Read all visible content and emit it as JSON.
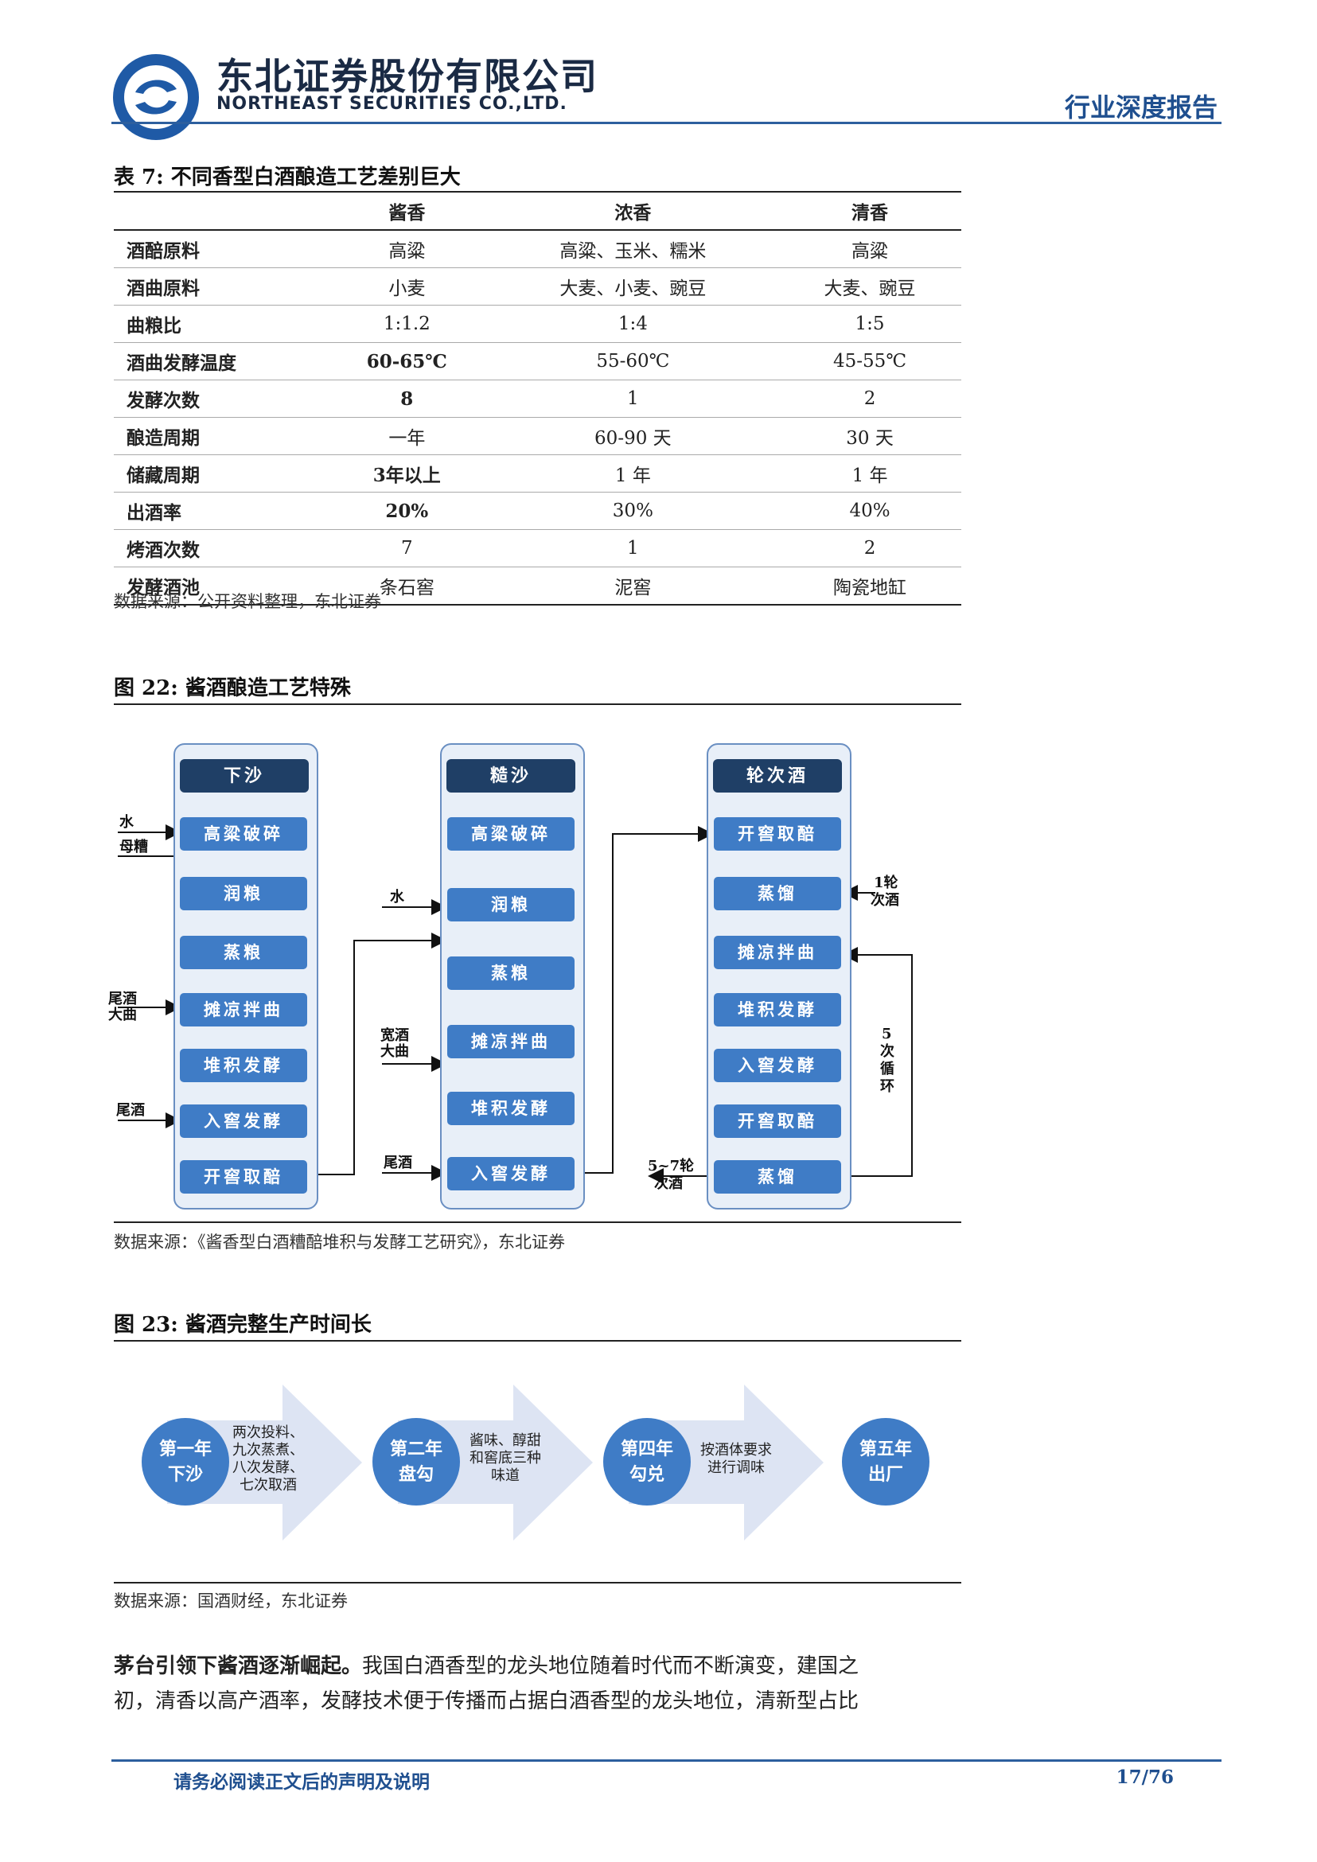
{
  "header": {
    "company_cn": "东北证券股份有限公司",
    "company_en": "NORTHEAST SECURITIES CO.,LTD.",
    "report_type": "行业深度报告"
  },
  "table7": {
    "title": "表 7: 不同香型白酒酿造工艺差别巨大",
    "columns": [
      "",
      "酱香",
      "浓香",
      "清香"
    ],
    "rows": [
      [
        "酒醅原料",
        "高粱",
        "高粱、玉米、糯米",
        "高粱"
      ],
      [
        "酒曲原料",
        "小麦",
        "大麦、小麦、豌豆",
        "大麦、豌豆"
      ],
      [
        "曲粮比",
        "1:1.2",
        "1:4",
        "1:5"
      ],
      [
        "酒曲发酵温度",
        "60-65℃",
        "55-60℃",
        "45-55℃"
      ],
      [
        "发酵次数",
        "8",
        "1",
        "2"
      ],
      [
        "酿造周期",
        "一年",
        "60-90 天",
        "30 天"
      ],
      [
        "储藏周期",
        "3年以上",
        "1 年",
        "1 年"
      ],
      [
        "出酒率",
        "20%",
        "30%",
        "40%"
      ],
      [
        "烤酒次数",
        "7",
        "1",
        "2"
      ],
      [
        "发酵酒池",
        "条石窖",
        "泥窖",
        "陶瓷地缸"
      ]
    ],
    "source": "数据来源：公开资料整理，东北证券"
  },
  "fig22": {
    "title": "图 22: 酱酒酿造工艺特殊",
    "col1": {
      "head": "下沙",
      "steps": [
        "高粱破碎",
        "润粮",
        "蒸粮",
        "摊凉拌曲",
        "堆积发酵",
        "入窖发酵",
        "开窖取醅"
      ]
    },
    "col2": {
      "head": "糙沙",
      "steps": [
        "高粱破碎",
        "润粮",
        "蒸粮",
        "摊凉拌曲",
        "堆积发酵",
        "入窖发酵"
      ]
    },
    "col3": {
      "head": "轮次酒",
      "steps": [
        "开窖取醅",
        "蒸馏",
        "摊凉拌曲",
        "堆积发酵",
        "入窖发酵",
        "开窖取醅",
        "蒸馏"
      ]
    },
    "labels": {
      "water1": "水",
      "mucao": "母糟",
      "weijiu_daqu_1": "尾酒",
      "weijiu_daqu_2": "大曲",
      "weijiu1": "尾酒",
      "water2": "水",
      "kuanjiu_1": "宽酒",
      "kuanjiu_2": "大曲",
      "weijiu2": "尾酒",
      "lun1_1": "1轮",
      "lun1_2": "次酒",
      "cycle_1": "5",
      "cycle_2": "次",
      "cycle_3": "循",
      "cycle_4": "环",
      "lun57_1": "5~7轮",
      "lun57_2": "次酒"
    },
    "source": "数据来源：《酱香型白酒糟醅堆积与发酵工艺研究》，东北证券"
  },
  "fig23": {
    "title": "图 23: 酱酒完整生产时间长",
    "stages": [
      {
        "year": "第一年",
        "name": "下沙",
        "desc": [
          "两次投料、",
          "九次蒸煮、",
          "八次发酵、",
          "七次取酒"
        ]
      },
      {
        "year": "第二年",
        "name": "盘勾",
        "desc": [
          "酱味、醇甜",
          "和窖底三种",
          "味道"
        ]
      },
      {
        "year": "第四年",
        "name": "勾兑",
        "desc": [
          "按酒体要求",
          "进行调味"
        ]
      },
      {
        "year": "第五年",
        "name": "出厂",
        "desc": []
      }
    ],
    "source": "数据来源：国酒财经，东北证券"
  },
  "body": {
    "lead": "茅台引领下酱酒逐渐崛起。",
    "line1": "我国白酒香型的龙头地位随着时代而不断演变，建国之",
    "line2": "初，清香以高产酒率，发酵技术便于传播而占据白酒香型的龙头地位，清新型占比"
  },
  "footer": {
    "notice": "请务必阅读正文后的声明及说明",
    "page": "17/76"
  }
}
